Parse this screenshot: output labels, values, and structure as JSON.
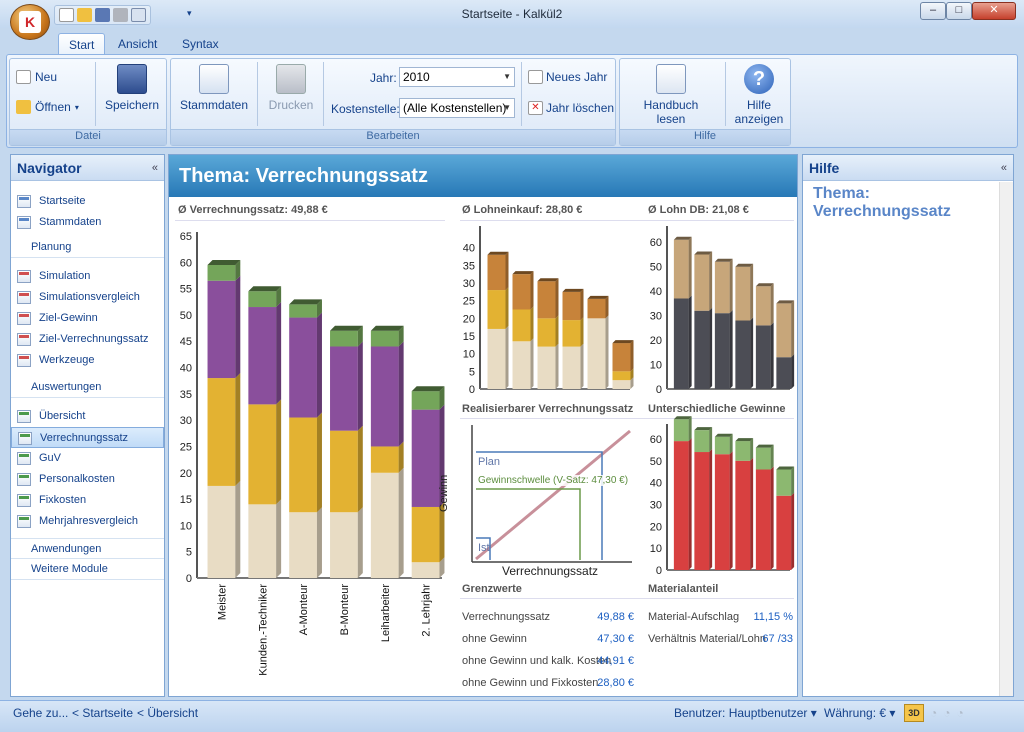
{
  "window": {
    "title": "Startseite - Kalkül2"
  },
  "ribbon": {
    "tabs": [
      "Start",
      "Ansicht",
      "Syntax"
    ],
    "datei": {
      "label": "Datei",
      "neu": "Neu",
      "oeffnen": "Öffnen",
      "speichern": "Speichern"
    },
    "bearbeiten": {
      "label": "Bearbeiten",
      "stammdaten": "Stammdaten",
      "drucken": "Drucken",
      "jahr_label": "Jahr:",
      "jahr_value": "2010",
      "kostenstelle_label": "Kostenstelle:",
      "kostenstelle_value": "(Alle Kostenstellen)",
      "neues_jahr": "Neues Jahr",
      "jahr_loeschen": "Jahr löschen"
    },
    "hilfe": {
      "label": "Hilfe",
      "handbuch1": "Handbuch",
      "handbuch2": "lesen",
      "hilfe1": "Hilfe",
      "hilfe2": "anzeigen"
    }
  },
  "navigator": {
    "title": "Navigator",
    "items_top": [
      "Startseite",
      "Stammdaten"
    ],
    "planung": {
      "header": "Planung",
      "items": [
        "Simulation",
        "Simulationsvergleich",
        "Ziel-Gewinn",
        "Ziel-Verrechnungssatz",
        "Werkzeuge"
      ]
    },
    "auswertungen": {
      "header": "Auswertungen",
      "items": [
        "Übersicht",
        "Verrechnungssatz",
        "GuV",
        "Personalkosten",
        "Fixkosten",
        "Mehrjahresvergleich"
      ]
    },
    "anwendungen": "Anwendungen",
    "weitere": "Weitere Module"
  },
  "main": {
    "title": "Thema: Verrechnungssatz",
    "chart1_title": "Ø Verrechnungssatz: 49,88 €",
    "chart2_title": "Ø Lohneinkauf: 28,80 €",
    "chart3_title": "Ø Lohn DB: 21,08 €",
    "chart4_title": "Realisierbarer Verrechnungssatz",
    "chart5_title": "Unterschiedliche Gewinne",
    "grenz_title": "Grenzwerte",
    "material_title": "Materialanteil",
    "grenz": [
      {
        "label": "Verrechnungssatz",
        "value": "49,88 €"
      },
      {
        "label": "ohne Gewinn",
        "value": "47,30 €"
      },
      {
        "label": "ohne Gewinn und kalk. Kosten",
        "value": "44,91 €"
      },
      {
        "label": "ohne Gewinn und Fixkosten",
        "value": "28,80 €"
      }
    ],
    "material": [
      {
        "label": "Material-Aufschlag",
        "value": "11,15 %"
      },
      {
        "label": "Verhältnis Material/Lohn",
        "value": "67 /33"
      }
    ],
    "line_chart": {
      "ylabel": "Gewinn",
      "xlabel": "Verrechnungssatz",
      "plan": "Plan",
      "schwelle": "Gewinnschwelle (V-Satz: 47,30 €)",
      "ist": "Ist"
    }
  },
  "chart_data": [
    {
      "type": "bar",
      "title": "Ø Verrechnungssatz: 49,88 €",
      "categories": [
        "Meister",
        "Kunden.-Techniker",
        "A-Monteur",
        "B-Monteur",
        "Leiharbeiter",
        "2. Lehrjahr"
      ],
      "ylim": [
        0,
        65
      ],
      "yticks": [
        0,
        5,
        10,
        15,
        20,
        25,
        30,
        35,
        40,
        45,
        50,
        55,
        60,
        65
      ],
      "series": [
        {
          "color": "#e8dcc4",
          "values": [
            17.5,
            14,
            12.5,
            12.5,
            20,
            3
          ]
        },
        {
          "color": "#e3b232",
          "values": [
            20.5,
            19,
            18,
            15.5,
            5,
            10.5
          ]
        },
        {
          "color": "#8a4f9c",
          "values": [
            18.5,
            18.5,
            19,
            16,
            19,
            18.5
          ]
        },
        {
          "color": "#74a55a",
          "values": [
            3,
            3,
            2.5,
            3,
            3,
            3.5
          ]
        }
      ]
    },
    {
      "type": "bar",
      "title": "Ø Lohneinkauf: 28,80 €",
      "ylim": [
        0,
        45
      ],
      "yticks": [
        0,
        5,
        10,
        15,
        20,
        25,
        30,
        35,
        40
      ],
      "series": [
        {
          "color": "#e8dcc4",
          "values": [
            17,
            13.5,
            12,
            12,
            20,
            2.5
          ]
        },
        {
          "color": "#e3b232",
          "values": [
            11,
            9,
            8,
            7.5,
            0,
            2.5
          ]
        },
        {
          "color": "#c7833a",
          "values": [
            10,
            10,
            10.5,
            8,
            5.5,
            8
          ]
        }
      ]
    },
    {
      "type": "bar",
      "title": "Ø Lohn DB: 21,08 €",
      "ylim": [
        0,
        65
      ],
      "yticks": [
        0,
        10,
        20,
        30,
        40,
        50,
        60
      ],
      "series": [
        {
          "color": "#4c4d55",
          "values": [
            37,
            32,
            31,
            28,
            26,
            13
          ]
        },
        {
          "color": "#c7a67a",
          "values": [
            24,
            23,
            21,
            22,
            16,
            22
          ]
        }
      ]
    },
    {
      "type": "bar",
      "title": "Unterschiedliche Gewinne",
      "ylim": [
        0,
        65
      ],
      "yticks": [
        0,
        10,
        20,
        30,
        40,
        50,
        60
      ],
      "series": [
        {
          "color": "#d84040",
          "values": [
            59,
            54,
            53,
            50,
            46,
            34
          ]
        },
        {
          "color": "#8cb870",
          "values": [
            10,
            10,
            8,
            9,
            10,
            12
          ]
        }
      ]
    }
  ]
}
